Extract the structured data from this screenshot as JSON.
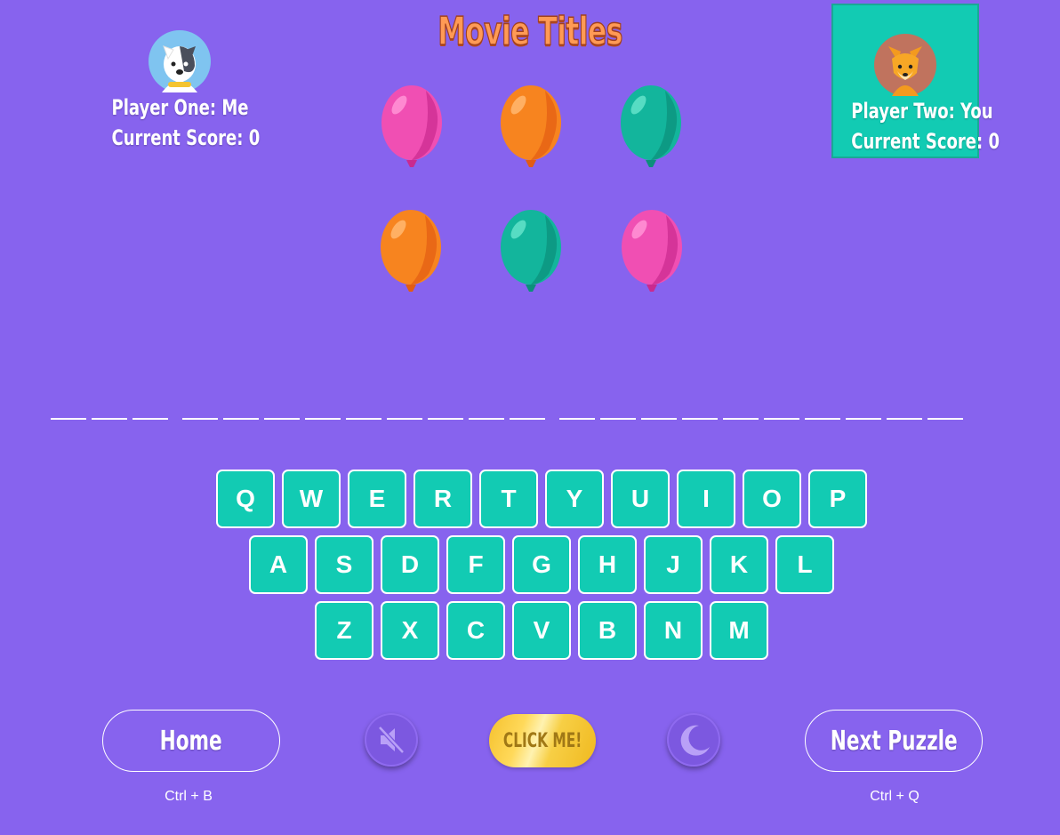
{
  "title": "Movie Titles",
  "player_one": {
    "name_line": "Player One: Me",
    "score_line": "Current Score: 0",
    "avatar_icon": "dog-avatar-icon"
  },
  "player_two": {
    "name_line": "Player Two: You",
    "score_line": "Current Score: 0",
    "avatar_icon": "fox-avatar-icon",
    "active_color": "#12cbb3"
  },
  "balloons": [
    {
      "color": "pink"
    },
    {
      "color": "orange"
    },
    {
      "color": "teal"
    },
    {
      "color": "orange"
    },
    {
      "color": "teal"
    },
    {
      "color": "pink"
    }
  ],
  "word_blanks": [
    3,
    9,
    10
  ],
  "keyboard": {
    "rows": [
      [
        "Q",
        "W",
        "E",
        "R",
        "T",
        "Y",
        "U",
        "I",
        "O",
        "P"
      ],
      [
        "A",
        "S",
        "D",
        "F",
        "G",
        "H",
        "J",
        "K",
        "L"
      ],
      [
        "Z",
        "X",
        "C",
        "V",
        "B",
        "N",
        "M"
      ]
    ],
    "key_color": "#12cbb3"
  },
  "buttons": {
    "home_label": "Home",
    "home_shortcut": "Ctrl + B",
    "next_label": "Next Puzzle",
    "next_shortcut": "Ctrl + Q",
    "click_me_label": "CLICK ME!",
    "mute_icon": "speaker-muted-icon",
    "theme_icon": "moon-icon"
  },
  "colors": {
    "background": "#8763ee",
    "title": "#ff9a55"
  }
}
